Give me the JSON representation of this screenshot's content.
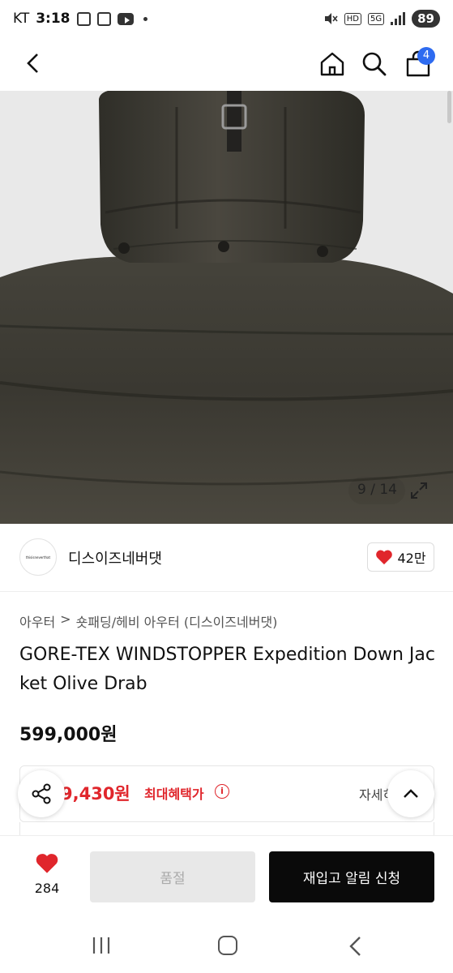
{
  "status_bar": {
    "carrier": "KT",
    "time": "3:18",
    "hd_label": "HD",
    "network_label": "5G",
    "battery": "89"
  },
  "top_nav": {
    "cart_count": "4"
  },
  "gallery": {
    "counter": "9 / 14"
  },
  "brand": {
    "logo_text": "thisisneverthat",
    "name": "디스이즈네버댓",
    "likes": "42만"
  },
  "breadcrumb": {
    "category": "아우터",
    "separator": ">",
    "subcategory": "숏패딩/헤비 아우터 (디스이즈네버댓)"
  },
  "product": {
    "title": "GORE-TEX WINDSTOPPER Expedition Down Jacket Olive Drab",
    "price": "599,000원"
  },
  "benefit": {
    "price": "9,430원",
    "label": "최대혜택가",
    "info_symbol": "i",
    "detail_link": "자세히"
  },
  "action_bar": {
    "wish_count": "284",
    "soldout_label": "품절",
    "restock_label": "재입고 알림 신청"
  },
  "colors": {
    "accent_blue": "#2e6bf0",
    "sale_red": "#e0262c",
    "heart_red": "#e0262c",
    "jacket_olive": "#3f3d35"
  }
}
